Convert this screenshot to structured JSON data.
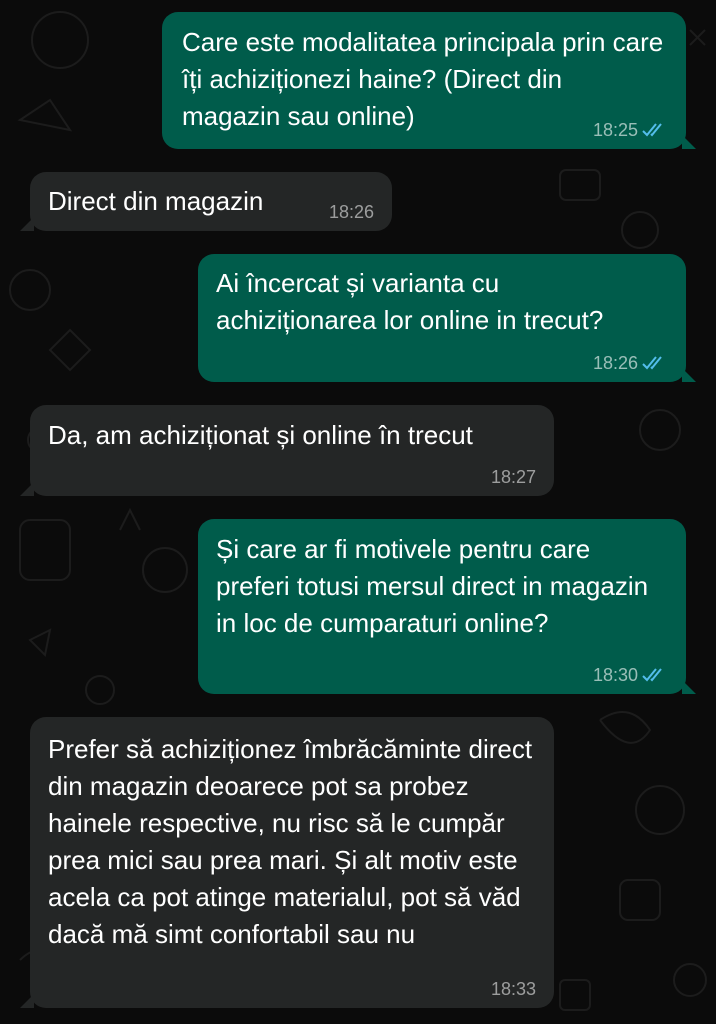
{
  "colors": {
    "background": "#0b0b0b",
    "outgoing_bubble": "#005c4b",
    "incoming_bubble": "#242626",
    "read_ticks": "#53bdeb"
  },
  "messages": [
    {
      "direction": "outgoing",
      "text": "Care este modalitatea principala prin care îți achiziționezi haine? (Direct din magazin sau online)",
      "time": "18:25",
      "status_icon": "double-check-read-icon"
    },
    {
      "direction": "incoming",
      "text": "Direct din magazin",
      "time": "18:26"
    },
    {
      "direction": "outgoing",
      "text": "Ai încercat și varianta cu achiziționarea lor online in trecut?",
      "time": "18:26",
      "status_icon": "double-check-read-icon"
    },
    {
      "direction": "incoming",
      "text": "Da, am achiziționat și online în trecut",
      "time": "18:27"
    },
    {
      "direction": "outgoing",
      "text": "Și care ar fi motivele pentru care preferi totusi mersul direct in magazin in loc de cumparaturi online?",
      "time": "18:30",
      "status_icon": "double-check-read-icon"
    },
    {
      "direction": "incoming",
      "text": "Prefer să achiziționez îmbrăcăminte direct din magazin deoarece pot sa probez hainele respective, nu risc să le cumpăr prea mici sau prea mari. Și alt motiv este acela ca pot atinge materialul, pot să văd dacă mă simt confortabil sau nu",
      "time": "18:33"
    }
  ]
}
